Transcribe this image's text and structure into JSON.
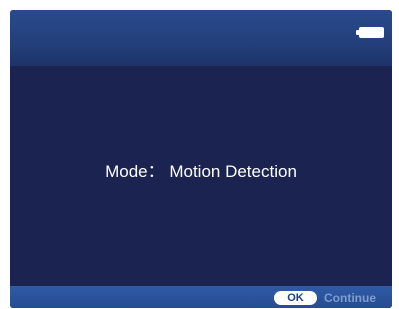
{
  "status_bar": {
    "battery_icon": "battery-icon",
    "battery_level": 1.0
  },
  "main": {
    "mode_text": "Mode： Motion Detection"
  },
  "footer": {
    "ok_label": "OK",
    "continue_label": "Continue"
  },
  "colors": {
    "screen_background": "#1b2450",
    "top_bar": "#24407c",
    "bottom_bar": "#2a529a",
    "text": "#ffffff",
    "continue_text": "#7f9ccf"
  }
}
